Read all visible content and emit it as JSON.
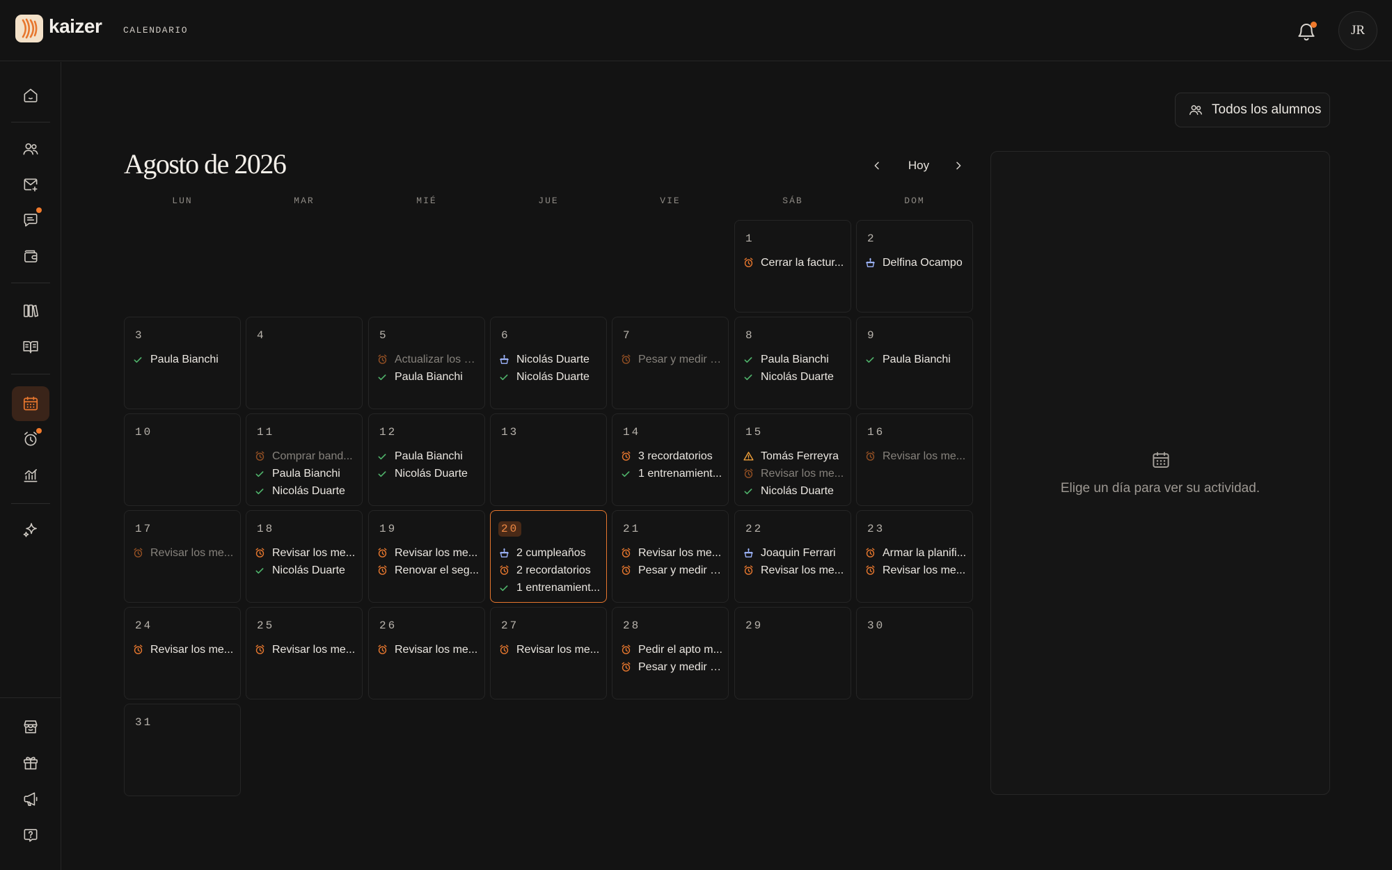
{
  "brand": {
    "name": "kaizer"
  },
  "header": {
    "section": "CALENDARIO",
    "avatar_initials": "JR",
    "has_notifications": true
  },
  "sidebar": {
    "icons": [
      "home-icon",
      "students-icon",
      "mail-icon",
      "chat-icon",
      "wallet-icon",
      "library-icon",
      "book-icon",
      "calendar-icon",
      "alarm-icon",
      "chart-icon",
      "sparkle-icon",
      "store-icon",
      "gift-icon",
      "megaphone-icon",
      "help-icon"
    ],
    "active": "calendar-icon"
  },
  "toolbar": {
    "filter_label": "Todos los alumnos",
    "today_label": "Hoy"
  },
  "calendar": {
    "title": "Agosto de 2026",
    "weekdays": [
      "LUN",
      "MAR",
      "MIÉ",
      "JUE",
      "VIE",
      "SÁB",
      "DOM"
    ],
    "selected_day": 20,
    "days": [
      {
        "day": "1",
        "events": [
          {
            "type": "reminder",
            "text": "Cerrar la factur..."
          }
        ]
      },
      {
        "day": "2",
        "events": [
          {
            "type": "birthday",
            "text": "Delfina Ocampo"
          }
        ]
      },
      {
        "day": "3",
        "events": [
          {
            "type": "check",
            "text": "Paula Bianchi"
          }
        ]
      },
      {
        "day": "4",
        "events": []
      },
      {
        "day": "5",
        "events": [
          {
            "type": "reminder",
            "text": "Actualizar los p...",
            "dim": true
          },
          {
            "type": "check",
            "text": "Paula Bianchi"
          }
        ]
      },
      {
        "day": "6",
        "events": [
          {
            "type": "birthday",
            "text": "Nicolás Duarte"
          },
          {
            "type": "check",
            "text": "Nicolás Duarte"
          }
        ]
      },
      {
        "day": "7",
        "events": [
          {
            "type": "reminder",
            "text": "Pesar y medir a...",
            "dim": true
          }
        ]
      },
      {
        "day": "8",
        "events": [
          {
            "type": "check",
            "text": "Paula Bianchi"
          },
          {
            "type": "check",
            "text": "Nicolás Duarte"
          }
        ]
      },
      {
        "day": "9",
        "events": [
          {
            "type": "check",
            "text": "Paula Bianchi"
          }
        ]
      },
      {
        "day": "10",
        "events": []
      },
      {
        "day": "11",
        "events": [
          {
            "type": "reminder",
            "text": "Comprar band...",
            "dim": true
          },
          {
            "type": "check",
            "text": "Paula Bianchi"
          },
          {
            "type": "check",
            "text": "Nicolás Duarte"
          }
        ]
      },
      {
        "day": "12",
        "events": [
          {
            "type": "check",
            "text": "Paula Bianchi"
          },
          {
            "type": "check",
            "text": "Nicolás Duarte"
          }
        ]
      },
      {
        "day": "13",
        "events": []
      },
      {
        "day": "14",
        "events": [
          {
            "type": "reminder",
            "text": "3 recordatorios"
          },
          {
            "type": "check",
            "text": "1 entrenamient..."
          }
        ]
      },
      {
        "day": "15",
        "events": [
          {
            "type": "warning",
            "text": "Tomás Ferreyra"
          },
          {
            "type": "reminder",
            "text": "Revisar los me...",
            "dim": true
          },
          {
            "type": "check",
            "text": "Nicolás Duarte"
          }
        ]
      },
      {
        "day": "16",
        "events": [
          {
            "type": "reminder",
            "text": "Revisar los me...",
            "dim": true
          }
        ]
      },
      {
        "day": "17",
        "events": [
          {
            "type": "reminder",
            "text": "Revisar los me...",
            "dim": true
          }
        ]
      },
      {
        "day": "18",
        "events": [
          {
            "type": "reminder",
            "text": "Revisar los me..."
          },
          {
            "type": "check",
            "text": "Nicolás Duarte"
          }
        ]
      },
      {
        "day": "19",
        "events": [
          {
            "type": "reminder",
            "text": "Revisar los me..."
          },
          {
            "type": "reminder",
            "text": "Renovar el seg..."
          }
        ]
      },
      {
        "day": "20",
        "events": [
          {
            "type": "birthday",
            "text": "2 cumpleaños"
          },
          {
            "type": "reminder",
            "text": "2 recordatorios"
          },
          {
            "type": "check",
            "text": "1 entrenamient..."
          }
        ]
      },
      {
        "day": "21",
        "events": [
          {
            "type": "reminder",
            "text": "Revisar los me..."
          },
          {
            "type": "reminder",
            "text": "Pesar y medir a..."
          }
        ]
      },
      {
        "day": "22",
        "events": [
          {
            "type": "birthday",
            "text": "Joaquin Ferrari"
          },
          {
            "type": "reminder",
            "text": "Revisar los me..."
          }
        ]
      },
      {
        "day": "23",
        "events": [
          {
            "type": "reminder",
            "text": "Armar la planifi..."
          },
          {
            "type": "reminder",
            "text": "Revisar los me..."
          }
        ]
      },
      {
        "day": "24",
        "events": [
          {
            "type": "reminder",
            "text": "Revisar los me..."
          }
        ]
      },
      {
        "day": "25",
        "events": [
          {
            "type": "reminder",
            "text": "Revisar los me..."
          }
        ]
      },
      {
        "day": "26",
        "events": [
          {
            "type": "reminder",
            "text": "Revisar los me..."
          }
        ]
      },
      {
        "day": "27",
        "events": [
          {
            "type": "reminder",
            "text": "Revisar los me..."
          }
        ]
      },
      {
        "day": "28",
        "events": [
          {
            "type": "reminder",
            "text": "Pedir el apto m..."
          },
          {
            "type": "reminder",
            "text": "Pesar y medir a..."
          }
        ]
      },
      {
        "day": "29",
        "events": []
      },
      {
        "day": "30",
        "events": []
      },
      {
        "day": "31",
        "events": []
      }
    ]
  },
  "detail_panel": {
    "empty_text": "Elige un día para ver su actividad."
  },
  "colors": {
    "accent": "#e7772e",
    "check": "#4fb36b",
    "birthday": "#9fb6ff",
    "warning": "#f0a03a",
    "background": "#131313"
  }
}
